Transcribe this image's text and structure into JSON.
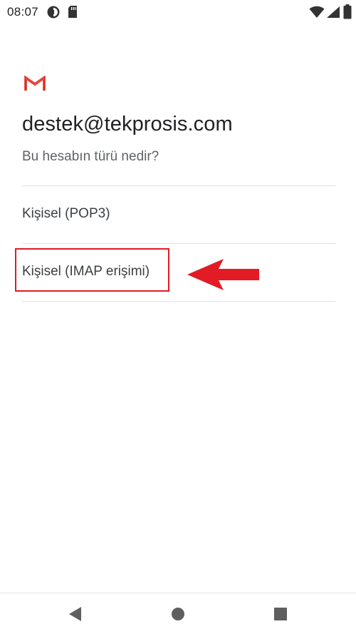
{
  "status_bar": {
    "time": "08:07",
    "icons": [
      "data-saver-icon",
      "sd-card-icon",
      "wifi-icon",
      "cell-signal-icon",
      "battery-icon"
    ]
  },
  "header": {
    "logo_icon": "gmail-m-icon",
    "email": "destek@tekprosis.com",
    "question": "Bu hesabın türü nedir?"
  },
  "options": [
    {
      "label": "Kişisel (POP3)"
    },
    {
      "label": "Kişisel (IMAP erişimi)"
    }
  ],
  "annotation": {
    "color": "#e21b24",
    "highlighted_option_index": 1
  },
  "nav_bar": {
    "icons": [
      "back-icon",
      "home-icon",
      "recents-icon"
    ]
  }
}
